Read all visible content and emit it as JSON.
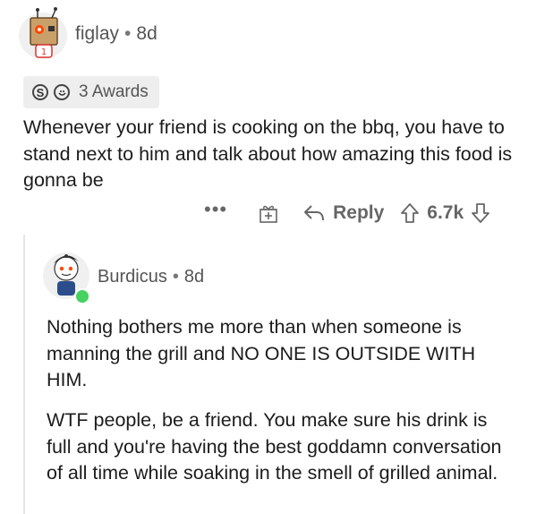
{
  "comment": {
    "username": "figlay",
    "separator": "•",
    "age": "8d",
    "awards": {
      "count_label": "3 Awards",
      "icons": [
        "silver-award-icon",
        "helpful-award-icon"
      ]
    },
    "body": "Whenever your friend is cooking on the bbq, you have to stand next to him and talk about how amazing this food is gonna be",
    "actions": {
      "more_label": "•••",
      "reply_label": "Reply",
      "score": "6.7k"
    }
  },
  "reply": {
    "username": "Burdicus",
    "separator": "•",
    "age": "8d",
    "online": true,
    "paragraphs": [
      "Nothing bothers me more than when someone is manning the grill and NO ONE IS OUTSIDE WITH HIM.",
      "WTF people, be a friend. You make sure his drink is full and you're having the best goddamn conversation of all time while soaking in the smell of grilled animal."
    ]
  },
  "colors": {
    "text": "#1c1c1c",
    "meta": "#555555",
    "online": "#46d160",
    "award_bg": "#eeeeee"
  }
}
